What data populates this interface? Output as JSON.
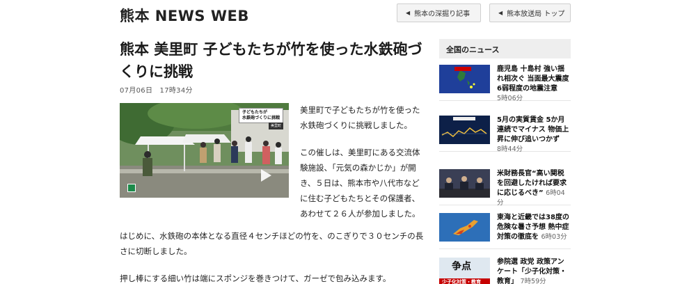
{
  "site": {
    "title": "熊本 NEWS WEB",
    "nav": [
      {
        "label": "熊本の深掘り記事",
        "icon": "triangle-left-icon"
      },
      {
        "label": "熊本放送局 トップ",
        "icon": "triangle-left-icon"
      }
    ]
  },
  "article": {
    "title": "熊本 美里町 子どもたちが竹を使った水鉄砲づくりに挑戦",
    "date": "07月06日　17時34分",
    "video": {
      "caption_line1": "子どもたちが",
      "caption_line2": "水鉄砲づくりに挑戦",
      "caption_sub": "美里町",
      "icon": "play-icon"
    },
    "paragraphs": [
      "美里町で子どもたちが竹を使った水鉄砲づくりに挑戦しました。",
      "この催しは、美里町にある交流体験施設、「元気の森かじか」が開き、５日は、熊本市や八代市などに住む子どもたちとその保護者、あわせて２６人が参加しました。",
      "はじめに、水鉄砲の本体となる直径４センチほどの竹を、のこぎりで３０センチの長さに切断しました。",
      "押し棒にする細い竹は端にスポンジを巻きつけて、ガーゼで包み込みます。"
    ]
  },
  "sidebar": {
    "header": "全国のニュース",
    "items": [
      {
        "title": "鹿児島 十島村 強い揺れ相次ぐ 当面最大震度6弱程度の地震注意",
        "time": "5時06分"
      },
      {
        "title": "5月の実質賃金 5か月連続でマイナス 物価上昇に伸び追いつかず",
        "time": "8時44分"
      },
      {
        "title": "米財務長官“高い関税を回避したければ要求に応じるべき”",
        "time": "6時04分"
      },
      {
        "title": "東海と近畿では38度の危険な暑さ予想 熱中症対策の徹底を",
        "time": "6時03分"
      },
      {
        "title": "参院選 政党 政策アンケート「少子化対策・教育」",
        "time": "7時59分",
        "thumb_text": "争点",
        "thumb_band": "少子化対策・教育"
      }
    ]
  }
}
